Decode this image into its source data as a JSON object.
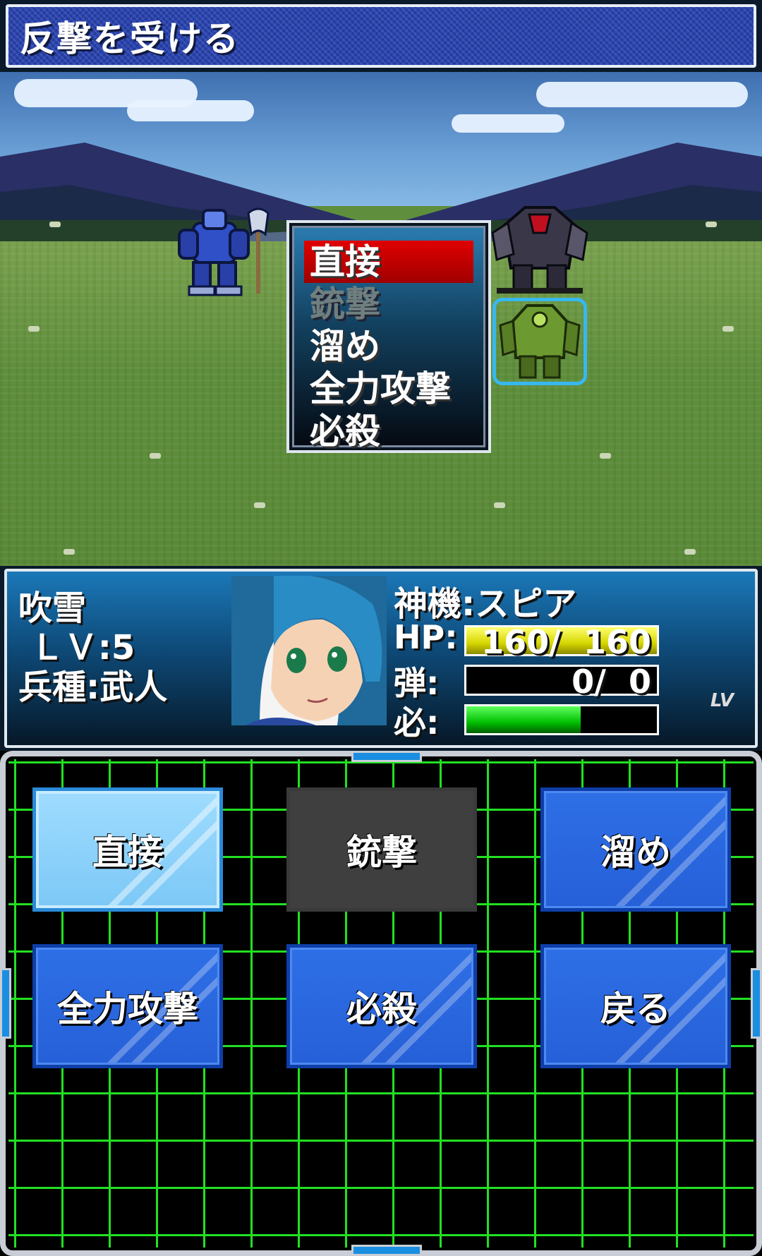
{
  "header": {
    "title": "反撃を受ける"
  },
  "battle_menu": {
    "items": [
      {
        "label": "直接",
        "state": "selected"
      },
      {
        "label": "銃撃",
        "state": "disabled"
      },
      {
        "label": "溜め",
        "state": "normal"
      },
      {
        "label": "全力攻撃",
        "state": "normal"
      },
      {
        "label": "必殺",
        "state": "normal"
      }
    ]
  },
  "status": {
    "pilot_name": "吹雪",
    "level": " ＬＶ:5",
    "class": "兵種:武人",
    "mech": "神機:スピア",
    "hp": {
      "label": "HP:",
      "current": 160,
      "max": 160,
      "text": "160/  160"
    },
    "ammo": {
      "label": "弾:",
      "current": 0,
      "max": 0,
      "text": "0/  0"
    },
    "special": {
      "label": "必:",
      "fill": 0.6,
      "lv_text": "LV"
    }
  },
  "commands": {
    "buttons": [
      {
        "label": "直接",
        "state": "selected"
      },
      {
        "label": "銃撃",
        "state": "disabled"
      },
      {
        "label": "溜め",
        "state": "normal"
      },
      {
        "label": "全力攻撃",
        "state": "normal"
      },
      {
        "label": "必殺",
        "state": "normal"
      },
      {
        "label": "戻る",
        "state": "normal"
      }
    ]
  },
  "colors": {
    "selected_menu": "#e00000",
    "button_blue": "#2e6fe6",
    "button_selected": "#8fd4ff",
    "grid_green": "#22e022",
    "hp_bar": "#e0e000",
    "special_bar": "#20d020"
  }
}
